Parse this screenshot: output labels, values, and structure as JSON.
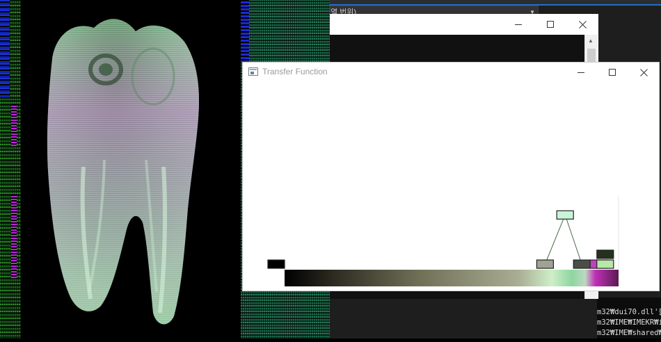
{
  "ide": {
    "combo_text": "열 번위)",
    "console_lines": [
      "m32₩dui70.dll'을",
      "m32₩IME₩IMEKR₩i",
      "m32₩IME₩shared₩"
    ]
  },
  "back_window": {
    "minimize_icon": "minimize-icon",
    "maximize_icon": "maximize-icon",
    "close_icon": "close-icon"
  },
  "tf_window": {
    "title": "Transfer Function",
    "app_icon": "window-app-icon",
    "gradient_stops": [
      "#000000",
      "#2e2b22",
      "#6f6f56",
      "#a9ad93",
      "#cfeec8",
      "#8ed6a0",
      "#bcd9c0",
      "#c030b8",
      "#5a1a50"
    ],
    "control_points": [
      {
        "color": "#000000",
        "value": 0.0,
        "opacity": 0.0
      },
      {
        "color": "#a0a294",
        "value": 0.78,
        "opacity": 0.0
      },
      {
        "color": "#c8f5d8",
        "value": 0.84,
        "opacity": 0.6
      },
      {
        "color": "#4a4f45",
        "value": 0.89,
        "opacity": 0.0
      },
      {
        "color": "#c040c0",
        "value": 0.94,
        "opacity": 0.0
      },
      {
        "color": "#b8e8a8",
        "value": 0.96,
        "opacity": 0.0
      },
      {
        "color": "#263021",
        "value": 0.96,
        "opacity": 0.12
      }
    ]
  },
  "colors": {
    "tooth_main": "#a8e6b4",
    "tooth_tint": "#d080d0",
    "ide_accent": "#1f6fc9"
  }
}
